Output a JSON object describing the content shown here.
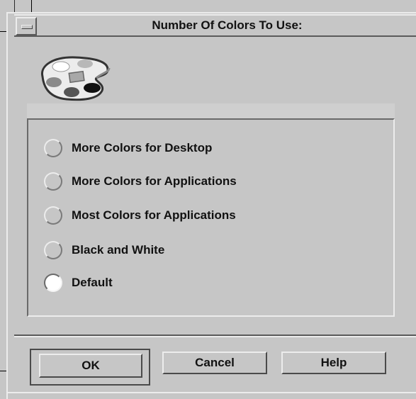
{
  "window": {
    "title": "Number Of Colors To Use:"
  },
  "icons": {
    "window_menu": "window-menu-icon",
    "palette": "palette-icon"
  },
  "options": [
    {
      "label": "More Colors for Desktop",
      "selected": false
    },
    {
      "label": "More Colors for Applications",
      "selected": false
    },
    {
      "label": "Most Colors for Applications",
      "selected": false
    },
    {
      "label": "Black and White",
      "selected": false
    },
    {
      "label": "Default",
      "selected": true
    }
  ],
  "buttons": {
    "ok": "OK",
    "cancel": "Cancel",
    "help": "Help"
  },
  "colors": {
    "background": "#c6c6c6",
    "highlight": "#ececec",
    "shadow": "#5a5a5a"
  }
}
